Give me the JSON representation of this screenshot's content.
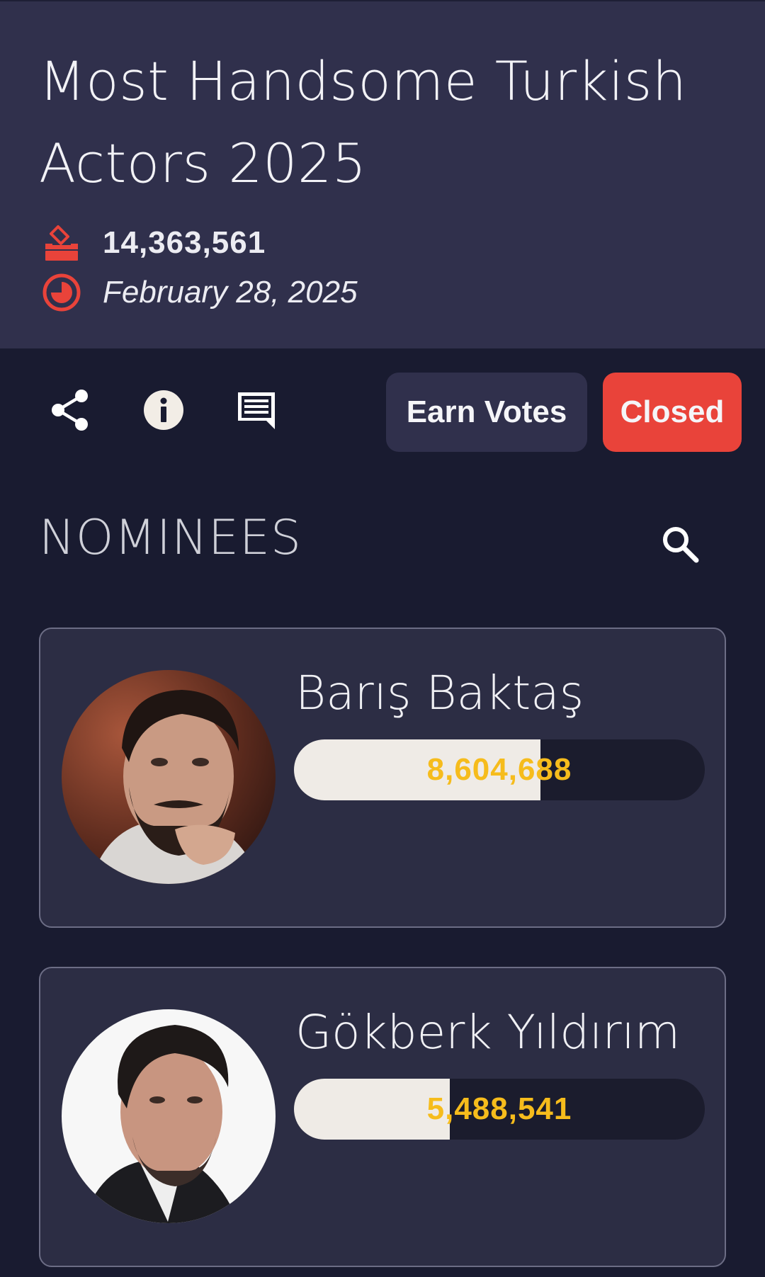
{
  "poll": {
    "title": "Most Handsome Turkish Actors 2025",
    "total_votes": "14,363,561",
    "end_date": "February 28, 2025"
  },
  "toolbar": {
    "share_icon": "share-icon",
    "info_icon": "info-icon",
    "comments_icon": "comments-icon",
    "earn_votes_label": "Earn Votes",
    "status_label": "Closed"
  },
  "nominees_section": {
    "title": "NOMINEES",
    "search_icon": "search-icon"
  },
  "nominees": [
    {
      "name": "Barış Baktaş",
      "votes": "8,604,688",
      "bar_fill_fraction": 0.6
    },
    {
      "name": "Gökberk Yıldırım",
      "votes": "5,488,541",
      "bar_fill_fraction": 0.38
    }
  ],
  "colors": {
    "header_bg": "#30304c",
    "page_bg": "#191b30",
    "accent_red": "#e9433a",
    "vote_count_gold": "#f6bc1c",
    "bar_fill": "#efebe6",
    "bar_track": "#1b1c2d"
  }
}
